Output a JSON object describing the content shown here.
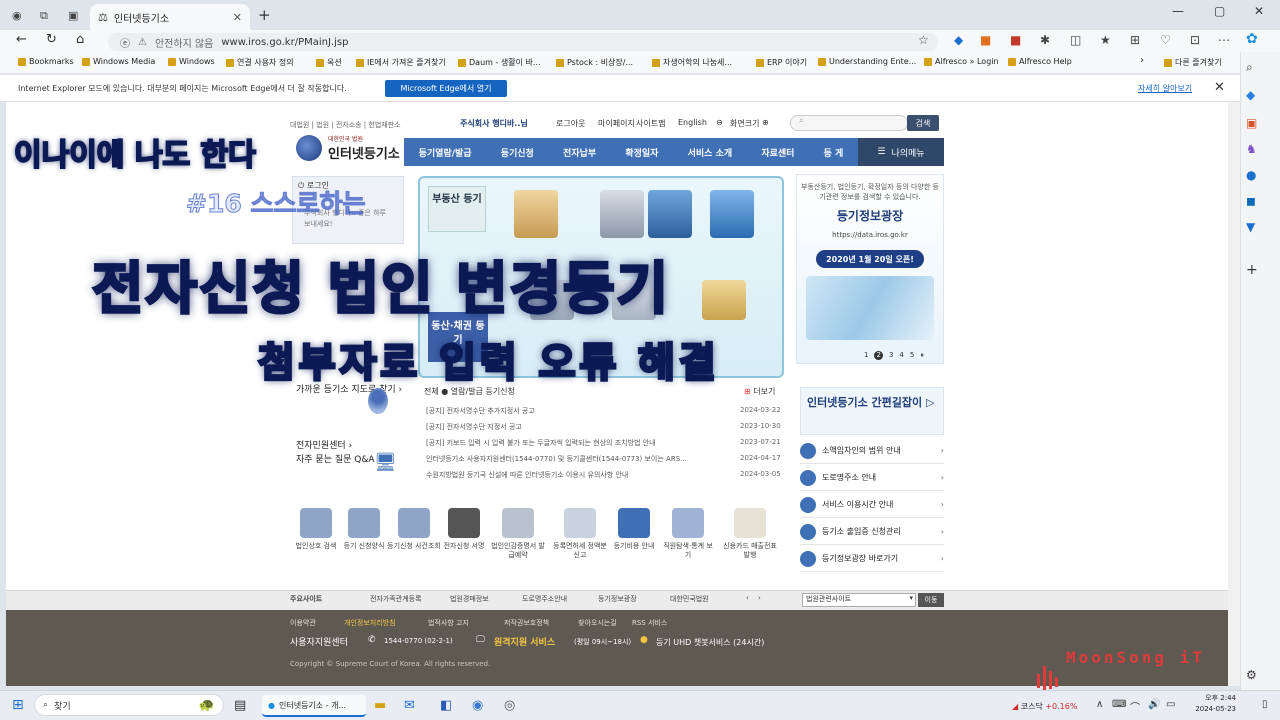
{
  "browser": {
    "tab_title": "인터넷등기소",
    "url_warning": "안전하지 않음",
    "url": "www.iros.go.kr/PMainJ.jsp",
    "bookmarks": [
      "Bookmarks",
      "Windows Media",
      "Windows",
      "연결 사용자 정의",
      "옥션",
      "IE에서 가져온 즐겨찾기",
      "Daum - 생활이 바...",
      "Pstock : 비상장/...",
      "자생어학의 나눔세...",
      "ERP 이야기",
      "Understanding Ente...",
      "Alfresco » Login",
      "Alfresco Help"
    ],
    "other_favorites": "다른 즐겨찾기",
    "ie_notice": "Internet Explorer 모드에 있습니다. 대부분의 페이지는 Microsoft Edge에서 더 잘 작동합니다.",
    "ie_open_button": "Microsoft Edge에서 열기",
    "ie_more": "자세히 알아보기"
  },
  "site": {
    "top_links": "대법원 | 법원 | 전자소송 | 헌법재판소",
    "user": "주식회사 행디바..님",
    "logout": "로그아웃",
    "mypage": "마이페이지",
    "sitemap": "사이트맵",
    "english": "English",
    "zoom": "화면크기",
    "search_button": "검색",
    "logo_sub": "대한민국 법원",
    "logo_title": "인터넷등기소",
    "gnb": [
      "등기열람/발급",
      "등기신청",
      "전자납부",
      "확정일자",
      "서비스 소개",
      "자료센터",
      "등 게"
    ],
    "my_menu": "나의메뉴",
    "login_label": "로그인",
    "login_text": "주식회사 행디바.. 좋은 하루 보내세요!",
    "banner_items": [
      "부동산 등기",
      "동산·채권 등기"
    ],
    "right_banner": {
      "text": "부동산등기, 법인등기, 확정일자 등의 다양한 등기관련 정보를 검색할 수 있습니다.",
      "title": "등기정보광장",
      "url": "https://data.iros.go.kr",
      "badge": "2020년 1월 20일 오픈!",
      "pager": [
        "1",
        "2",
        "3",
        "4",
        "5"
      ]
    },
    "map_card": "가까운 등기소 지도로 찾기 ›",
    "civil_center": "전자민원센터 ›",
    "faq": "자주 묻는 질문 Q&A",
    "notice_tabs": "전체 ●  열람/발급   등기신청",
    "notice_more": "더보기",
    "notices": [
      {
        "title": "[공지] 전자서명수단 추가지정서 공고",
        "date": "2024-03-22"
      },
      {
        "title": "[공지] 전자서명수단 지정서 공고",
        "date": "2023-10-30"
      },
      {
        "title": "[공지] 키보드 입력 시 입력 불가 또는 두글자씩 입력되는 현상의 조치방법 안내",
        "date": "2023-07-21"
      },
      {
        "title": "인터넷등기소 사용자지원센터(1544-0770) 및 등기콜센터(1544-0773) 보이는 ARS...",
        "date": "2024-04-17"
      },
      {
        "title": "수원지방법원 등기국 신설에 따른 인터넷등기소 이용시 유의사항 안내",
        "date": "2024-03-05"
      }
    ],
    "guide": "인터넷등기소 간편길잡이",
    "right_links": [
      "소액임차인의 범위 안내",
      "도로명주소 안내",
      "서비스 이용시간 안내",
      "등기소 출입증 신청관리",
      "등기정보광장 바로가기"
    ],
    "quick_links": [
      "법인상호 검색",
      "등기 신청양식",
      "등기신청 사건조회",
      "전자신청 서명",
      "법인인감증명서 발급예약",
      "등록면허세 정액분 신고",
      "등기비용 안내",
      "직원탐색·통계 보기",
      "신용카드 매출전표 발행"
    ],
    "footer_bar": {
      "label": "주요사이트",
      "links": [
        "전자가족관계등록",
        "법원경매정보",
        "도로명주소안내",
        "등기정보광장",
        "대한민국법원"
      ],
      "select": "법원관련사이트",
      "go": "이동"
    },
    "footer_links": [
      "이용약관",
      "개인정보처리방침",
      "법적사항 고지",
      "저작권보호정책",
      "찾아오시는길",
      "RSS 서비스"
    ],
    "support": "사용자지원센터",
    "phone": "1544-0770 (02-2-1)",
    "remote": "원격지원 서비스",
    "remote_hours": "(평일 09시~18시)",
    "chatbot": "등기 UHD 챗봇서비스 (24시간)",
    "copyright": "Copyright © Supreme Court of Korea. All rights reserved."
  },
  "overlay": {
    "line1": "이나이에 나도 한다",
    "line2": "#16 스스로하는",
    "line3": "전자신청 법인 변경등기",
    "line4": "첨부자료 입력 오류 해결",
    "watermark": "MoonSong iT"
  },
  "taskbar": {
    "search": "찾기",
    "task_title": "인터넷등기소 - 개...",
    "kospi_label": "코스닥",
    "kospi_change": "+0.16%",
    "time": "오후 2:44",
    "date": "2024-05-23"
  }
}
